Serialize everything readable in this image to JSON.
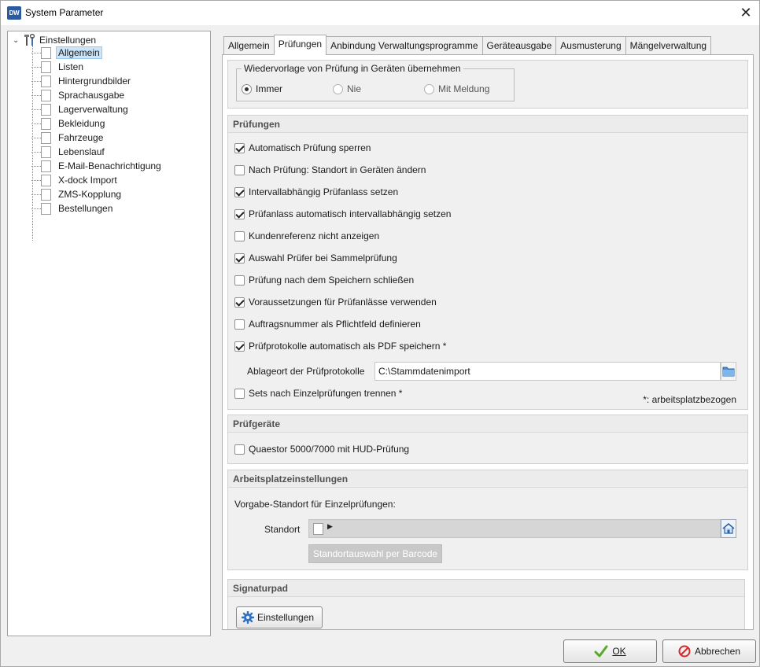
{
  "window": {
    "title": "System Parameter",
    "app_icon_text": "DW",
    "close_glyph": "✕"
  },
  "tree": {
    "root_label": "Einstellungen",
    "items": [
      {
        "label": "Allgemein",
        "selected": true
      },
      {
        "label": "Listen"
      },
      {
        "label": "Hintergrundbilder"
      },
      {
        "label": "Sprachausgabe"
      },
      {
        "label": "Lagerverwaltung"
      },
      {
        "label": "Bekleidung"
      },
      {
        "label": "Fahrzeuge"
      },
      {
        "label": "Lebenslauf"
      },
      {
        "label": "E-Mail-Benachrichtigung"
      },
      {
        "label": "X-dock Import"
      },
      {
        "label": "ZMS-Kopplung"
      },
      {
        "label": "Bestellungen"
      }
    ]
  },
  "tabs": [
    {
      "label": "Allgemein"
    },
    {
      "label": "Prüfungen",
      "active": true
    },
    {
      "label": "Anbindung Verwaltungsprogramme"
    },
    {
      "label": "Geräteausgabe"
    },
    {
      "label": "Ausmusterung"
    },
    {
      "label": "Mängelverwaltung"
    }
  ],
  "template_section": {
    "legend": "Wiedervorlage von Prüfung in Geräten übernehmen",
    "options": [
      {
        "label": "Immer",
        "selected": true
      },
      {
        "label": "Nie",
        "selected": false
      },
      {
        "label": "Mit Meldung",
        "selected": false
      }
    ]
  },
  "pruefungen": {
    "header": "Prüfungen",
    "checkboxes": [
      {
        "label": "Automatisch Prüfung sperren",
        "checked": true
      },
      {
        "label": "Nach Prüfung: Standort in Geräten ändern",
        "checked": false
      },
      {
        "label": "Intervallabhängig Prüfanlass setzen",
        "checked": true
      },
      {
        "label": "Prüfanlass automatisch intervallabhängig setzen",
        "checked": true
      },
      {
        "label": "Kundenreferenz nicht anzeigen",
        "checked": false
      },
      {
        "label": "Auswahl Prüfer bei Sammelprüfung",
        "checked": true
      },
      {
        "label": "Prüfung nach dem Speichern schließen",
        "checked": false
      },
      {
        "label": "Voraussetzungen für Prüfanlässe verwenden",
        "checked": true
      },
      {
        "label": "Auftragsnummer als Pflichtfeld definieren",
        "checked": false
      },
      {
        "label": "Prüfprotokolle automatisch als PDF speichern *",
        "checked": true
      }
    ],
    "path_label": "Ablageort der Prüfprotokolle",
    "path_value": "C:\\Stammdatenimport",
    "sets_checkbox": {
      "label": "Sets nach Einzelprüfungen trennen *",
      "checked": false
    },
    "footnote": "*: arbeitsplatzbezogen"
  },
  "pruefgeraete": {
    "header": "Prüfgeräte",
    "checkbox": {
      "label": "Quaestor 5000/7000 mit HUD-Prüfung",
      "checked": false
    }
  },
  "arbeitsplatz": {
    "header": "Arbeitsplatzeinstellungen",
    "subtitle": "Vorgabe-Standort für Einzelprüfungen:",
    "standort_label": "Standort",
    "barcode_button": "Standortauswahl per Barcode"
  },
  "signaturpad": {
    "header": "Signaturpad",
    "button": "Einstellungen"
  },
  "footer": {
    "ok_label": "OK",
    "cancel_label": "Abbrechen"
  },
  "colors": {
    "selection_bg": "#cce4f7",
    "ok_check": "#5aaa2a",
    "cancel_red": "#d42a2a",
    "gear_blue": "#2f6fc0"
  }
}
